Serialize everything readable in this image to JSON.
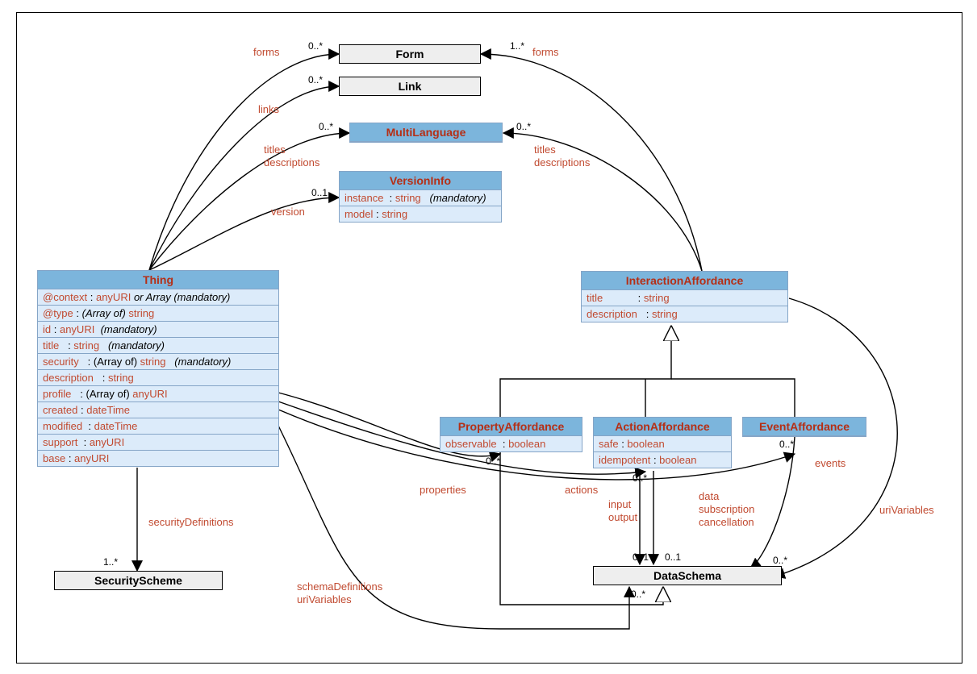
{
  "classes": {
    "Thing": {
      "name": "Thing",
      "attrs": [
        {
          "name": "@context",
          "type": "anyURI",
          "note": "or Array (mandatory)"
        },
        {
          "name": "@type",
          "pre": "(Array of) ",
          "type": "string"
        },
        {
          "name": "id",
          "type": "anyURI",
          "note": "(mandatory)"
        },
        {
          "name": "title",
          "type": "string",
          "note": "(mandatory)"
        },
        {
          "name": "security",
          "pre": "(Array of) ",
          "type": "string",
          "note": "(mandatory)"
        },
        {
          "name": "description",
          "type": "string"
        },
        {
          "name": "profile",
          "pre": "(Array of) ",
          "type": "anyURI"
        },
        {
          "name": "created",
          "type": "dateTime"
        },
        {
          "name": "modified",
          "type": "dateTime"
        },
        {
          "name": "support",
          "type": "anyURI"
        },
        {
          "name": "base",
          "type": "anyURI"
        }
      ]
    },
    "VersionInfo": {
      "name": "VersionInfo",
      "attrs": [
        {
          "name": "instance",
          "type": "string",
          "note": "(mandatory)"
        },
        {
          "name": "model",
          "type": "string"
        }
      ]
    },
    "MultiLanguage": {
      "name": "MultiLanguage"
    },
    "InteractionAffordance": {
      "name": "InteractionAffordance",
      "attrs": [
        {
          "name": "title",
          "type": "string"
        },
        {
          "name": "description",
          "type": "string"
        }
      ]
    },
    "PropertyAffordance": {
      "name": "PropertyAffordance",
      "attrs": [
        {
          "name": "observable",
          "type": "boolean"
        }
      ]
    },
    "ActionAffordance": {
      "name": "ActionAffordance",
      "attrs": [
        {
          "name": "safe",
          "type": "boolean"
        },
        {
          "name": "idempotent",
          "type": "boolean"
        }
      ]
    },
    "EventAffordance": {
      "name": "EventAffordance"
    }
  },
  "grey": {
    "Form": "Form",
    "Link": "Link",
    "SecurityScheme": "SecurityScheme",
    "DataSchema": "DataSchema"
  },
  "labels": {
    "forms": "forms",
    "links": "links",
    "titles": "titles",
    "descriptions": "descriptions",
    "version": "version",
    "securityDefinitions": "securityDefinitions",
    "properties": "properties",
    "actions": "actions",
    "events": "events",
    "input": "input",
    "output": "output",
    "data": "data",
    "subscription": "subscription",
    "cancellation": "cancellation",
    "schemaDefinitions": "schemaDefinitions",
    "uriVariables": "uriVariables"
  },
  "mult": {
    "zeroMany": "0..*",
    "oneMany": "1..*",
    "zeroOne": "0..1"
  }
}
